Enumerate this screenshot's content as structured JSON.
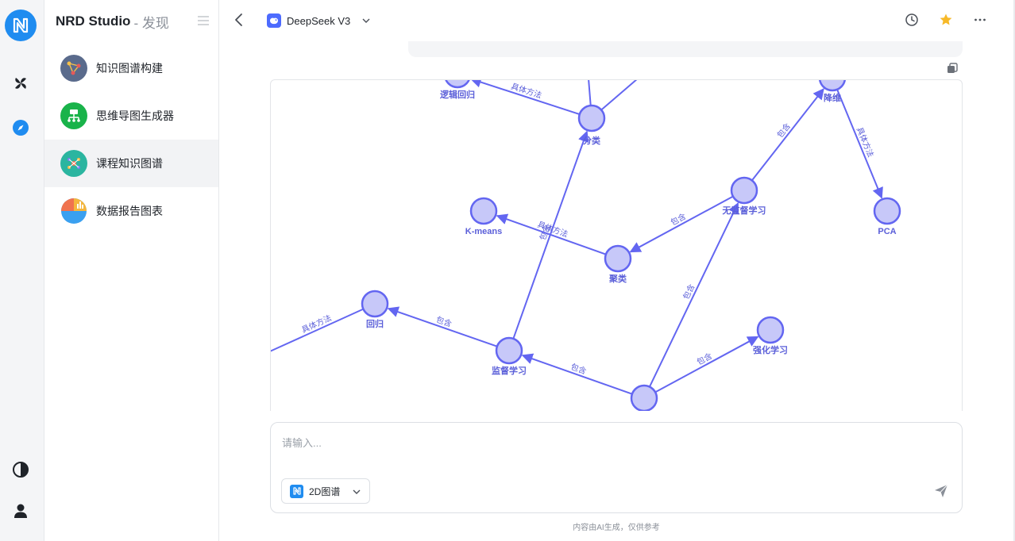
{
  "rail": {
    "items": [
      {
        "name": "nrd-logo"
      },
      {
        "name": "pinwheel-icon"
      },
      {
        "name": "compass-icon"
      },
      {
        "name": "theme-toggle-icon"
      },
      {
        "name": "user-icon"
      }
    ]
  },
  "sidebar": {
    "title": "NRD Studio",
    "subtitle": "- 发现",
    "items": [
      {
        "label": "知识图谱构建",
        "icon": "graph-network-icon",
        "color": "#5a6b8c"
      },
      {
        "label": "思维导图生成器",
        "icon": "mindmap-icon",
        "color": "#19b34a"
      },
      {
        "label": "课程知识图谱",
        "icon": "course-graph-icon",
        "color": "#2bb5a0",
        "active": true
      },
      {
        "label": "数据报告图表",
        "icon": "pie-chart-icon",
        "color": "#f5b63d"
      }
    ]
  },
  "topbar": {
    "model_name": "DeepSeek V3",
    "model_icon": "deepseek-whale-icon"
  },
  "graph": {
    "accent": "#6366f1",
    "node_fill": "#c7c8f9",
    "nodes": [
      {
        "id": "logistic",
        "label": "逻辑回归"
      },
      {
        "id": "classification",
        "label": "分类"
      },
      {
        "id": "dimred",
        "label": "降维"
      },
      {
        "id": "unsupervised",
        "label": "无监督学习"
      },
      {
        "id": "pca",
        "label": "PCA"
      },
      {
        "id": "kmeans",
        "label": "K-means"
      },
      {
        "id": "clustering",
        "label": "聚类"
      },
      {
        "id": "regression",
        "label": "回归"
      },
      {
        "id": "supervised",
        "label": "监督学习"
      },
      {
        "id": "reinforcement",
        "label": "强化学习"
      },
      {
        "id": "ml",
        "label": ""
      }
    ],
    "edges": [
      {
        "from": "classification",
        "to": "logistic",
        "label": "具体方法"
      },
      {
        "from": "unsupervised",
        "to": "dimred",
        "label": "包含"
      },
      {
        "from": "dimred",
        "to": "pca",
        "label": "具体方法"
      },
      {
        "from": "unsupervised",
        "to": "clustering",
        "label": "包含"
      },
      {
        "from": "clustering",
        "to": "kmeans",
        "label": "具体方法"
      },
      {
        "from": "supervised",
        "to": "classification",
        "label": "包含"
      },
      {
        "from": "ml",
        "to": "unsupervised",
        "label": "包含"
      },
      {
        "from": "ml",
        "to": "reinforcement",
        "label": "包含"
      },
      {
        "from": "ml",
        "to": "supervised",
        "label": "包含"
      },
      {
        "from": "supervised",
        "to": "regression",
        "label": "包含"
      },
      {
        "from": "regression",
        "to": "offscreen",
        "label": "具体方法"
      }
    ]
  },
  "composer": {
    "placeholder": "请输入...",
    "mode_label": "2D图谱",
    "footnote": "内容由AI生成，仅供参考"
  }
}
